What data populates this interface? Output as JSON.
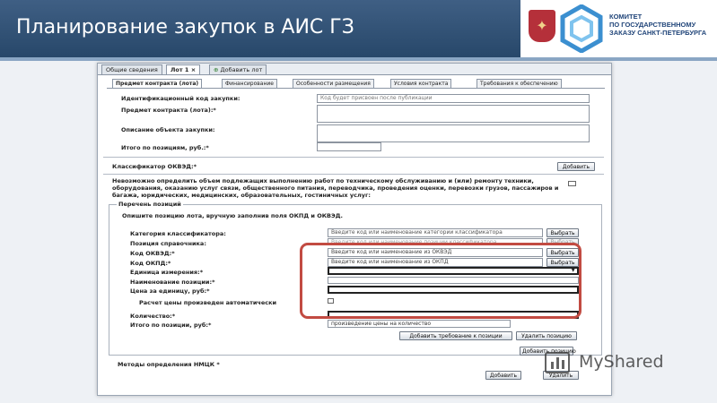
{
  "slide": {
    "title": "Планирование закупок в АИС ГЗ",
    "logo_lines": [
      "КОМИТЕТ",
      "ПО ГОСУДАРСТВЕННОМУ",
      "ЗАКАЗУ САНКТ-ПЕТЕРБУРГА"
    ],
    "watermark": "MyShared"
  },
  "tabs_top": [
    "Общие сведения",
    "Лот 1",
    "Добавить лот"
  ],
  "tabs_sub": [
    "Предмет контракта (лота)",
    "Финансирование",
    "Особенности размещения",
    "Условия контракта",
    "Требования к обеспечению"
  ],
  "form": {
    "id_label": "Идентификационный код закупки:",
    "id_value": "Код будет присвоен после публикации",
    "subject_label": "Предмет контракта (лота):*",
    "description_label": "Описание объекта закупки:",
    "total_label": "Итого по позициям, руб.:*",
    "okved_label": "Классификатор ОКВЭД:*",
    "add_label": "Добавить",
    "notice": "Невозможно определить объем подлежащих выполнению работ по техническому обслуживанию и (или) ремонту техники, оборудования, оказанию услуг связи, общественного питания, переводчика, проведения оценки, перевозки грузов, пассажиров и багажа, юридических, медицинских, образовательных, гостиничных услуг:"
  },
  "positions": {
    "legend": "Перечень позиций",
    "instruction": "Опишите позицию лота, вручную заполнив поля ОКПД и ОКВЭД.",
    "category_label": "Категория классификатора:",
    "category_placeholder": "Введите код или наименование категории классификатора",
    "reference_label": "Позиция справочника:",
    "reference_placeholder": "Введите код или наименование позиции классификатора",
    "okved_label": "Код ОКВЭД:*",
    "okved_placeholder": "Введите код или наименование из ОКВЭД",
    "okpd_label": "Код ОКПД:*",
    "okpd_placeholder": "Введите код или наименование из ОКПД",
    "unit_label": "Единица измерения:*",
    "name_label": "Наименование позиции:*",
    "price_label": "Цена за единицу, руб:*",
    "auto_calc_label": "Расчет цены произведен автоматически",
    "quantity_label": "Количество:*",
    "total_label": "Итого по позиции, руб:*",
    "total_value": "произведение цены на количество",
    "select_label": "Выбрать",
    "add_requirement": "Добавить требование к позиции",
    "delete_position": "Удалить позицию",
    "add_position": "Добавить позицию"
  },
  "methods": {
    "label": "Методы определения НМЦК *",
    "add_label": "Добавить",
    "delete_label": "Удалить"
  }
}
